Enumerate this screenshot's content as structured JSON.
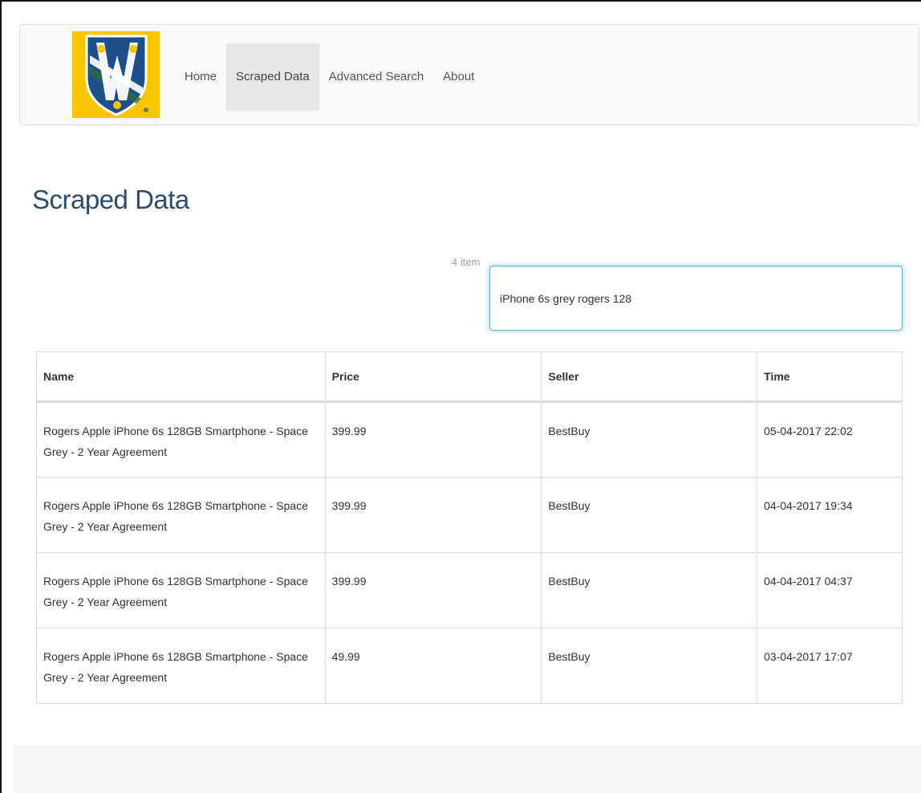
{
  "nav": {
    "items": [
      {
        "label": "Home",
        "active": false
      },
      {
        "label": "Scraped Data",
        "active": true
      },
      {
        "label": "Advanced Search",
        "active": false
      },
      {
        "label": "About",
        "active": false
      }
    ]
  },
  "page": {
    "title": "Scraped Data",
    "item_count": "4 item"
  },
  "search": {
    "value": "iPhone 6s grey rogers 128"
  },
  "table": {
    "headers": [
      "Name",
      "Price",
      "Seller",
      "Time"
    ],
    "rows": [
      {
        "name": "Rogers Apple iPhone 6s 128GB Smartphone - Space Grey - 2 Year Agreement",
        "price": "399.99",
        "seller": "BestBuy",
        "time": "05-04-2017 22:02"
      },
      {
        "name": "Rogers Apple iPhone 6s 128GB Smartphone - Space Grey - 2 Year Agreement",
        "price": "399.99",
        "seller": "BestBuy",
        "time": "04-04-2017 19:34"
      },
      {
        "name": "Rogers Apple iPhone 6s 128GB Smartphone - Space Grey - 2 Year Agreement",
        "price": "399.99",
        "seller": "BestBuy",
        "time": "04-04-2017 04:37"
      },
      {
        "name": "Rogers Apple iPhone 6s 128GB Smartphone - Space Grey - 2 Year Agreement",
        "price": "49.99",
        "seller": "BestBuy",
        "time": "03-04-2017 17:07"
      }
    ]
  },
  "colors": {
    "title": "#2a4d6e",
    "logo_background": "#f7c600",
    "logo_shield": "#1f4f8b",
    "nav_active": "#e7e7e7",
    "input_focus": "#66afe9"
  },
  "icons": {
    "logo": "university-shield-logo"
  }
}
